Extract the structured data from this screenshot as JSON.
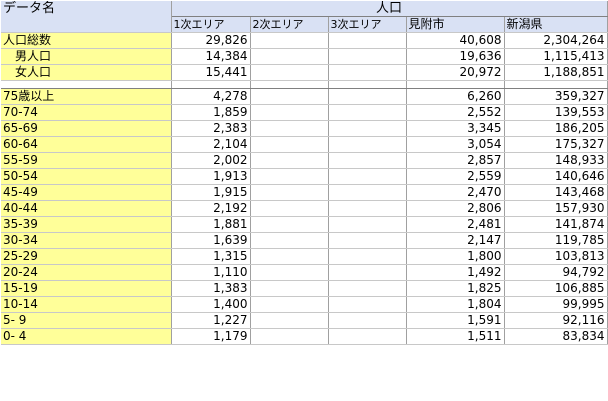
{
  "header": {
    "label": "データ名",
    "group": "人口",
    "columns": [
      "1次エリア",
      "2次エリア",
      "3次エリア",
      "見附市",
      "新潟県"
    ]
  },
  "totals": [
    {
      "label": "人口総数",
      "values": [
        "29,826",
        "",
        "",
        "40,608",
        "2,304,264"
      ]
    },
    {
      "label": "男人口",
      "values": [
        "14,384",
        "",
        "",
        "19,636",
        "1,115,413"
      ]
    },
    {
      "label": "女人口",
      "values": [
        "15,441",
        "",
        "",
        "20,972",
        "1,188,851"
      ]
    }
  ],
  "ages": [
    {
      "label": "75歳以上",
      "values": [
        "4,278",
        "",
        "",
        "6,260",
        "359,327"
      ]
    },
    {
      "label": "70-74",
      "values": [
        "1,859",
        "",
        "",
        "2,552",
        "139,553"
      ]
    },
    {
      "label": "65-69",
      "values": [
        "2,383",
        "",
        "",
        "3,345",
        "186,205"
      ]
    },
    {
      "label": "60-64",
      "values": [
        "2,104",
        "",
        "",
        "3,054",
        "175,327"
      ]
    },
    {
      "label": "55-59",
      "values": [
        "2,002",
        "",
        "",
        "2,857",
        "148,933"
      ]
    },
    {
      "label": "50-54",
      "values": [
        "1,913",
        "",
        "",
        "2,559",
        "140,646"
      ]
    },
    {
      "label": "45-49",
      "values": [
        "1,915",
        "",
        "",
        "2,470",
        "143,468"
      ]
    },
    {
      "label": "40-44",
      "values": [
        "2,192",
        "",
        "",
        "2,806",
        "157,930"
      ]
    },
    {
      "label": "35-39",
      "values": [
        "1,881",
        "",
        "",
        "2,481",
        "141,874"
      ]
    },
    {
      "label": "30-34",
      "values": [
        "1,639",
        "",
        "",
        "2,147",
        "119,785"
      ]
    },
    {
      "label": "25-29",
      "values": [
        "1,315",
        "",
        "",
        "1,800",
        "103,813"
      ]
    },
    {
      "label": "20-24",
      "values": [
        "1,110",
        "",
        "",
        "1,492",
        "94,792"
      ]
    },
    {
      "label": "15-19",
      "values": [
        "1,383",
        "",
        "",
        "1,825",
        "106,885"
      ]
    },
    {
      "label": "10-14",
      "values": [
        "1,400",
        "",
        "",
        "1,804",
        "99,995"
      ]
    },
    {
      "label": "5- 9",
      "values": [
        "1,227",
        "",
        "",
        "1,591",
        "92,116"
      ]
    },
    {
      "label": "0- 4",
      "values": [
        "1,179",
        "",
        "",
        "1,511",
        "83,834"
      ]
    }
  ],
  "colors": {
    "header_bg": "#d9e1f4",
    "label_bg": "#ffff99"
  }
}
